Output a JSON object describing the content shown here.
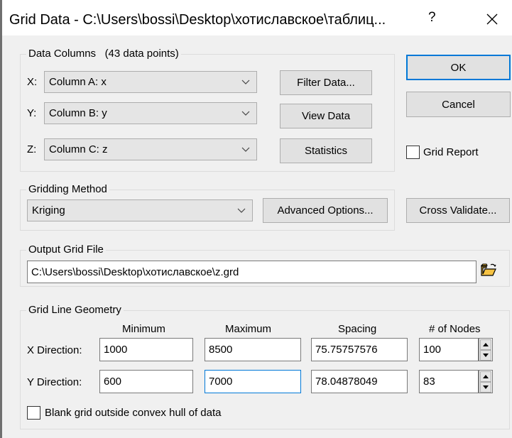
{
  "window": {
    "title": "Grid Data - C:\\Users\\bossi\\Desktop\\хотиславское\\таблиц...",
    "help_label": "?"
  },
  "data_columns": {
    "legend": "Data Columns",
    "count": "(43 data points)",
    "x_label": "X:",
    "x_value": "Column A:  x",
    "y_label": "Y:",
    "y_value": "Column B:  y",
    "z_label": "Z:",
    "z_value": "Column C:  z",
    "filter_button": "Filter Data...",
    "view_button": "View Data",
    "statistics_button": "Statistics"
  },
  "actions": {
    "ok": "OK",
    "cancel": "Cancel",
    "grid_report": "Grid Report",
    "cross_validate": "Cross Validate..."
  },
  "gridding_method": {
    "legend": "Gridding Method",
    "value": "Kriging",
    "advanced_button": "Advanced Options..."
  },
  "output_grid": {
    "legend": "Output Grid File",
    "path": "C:\\Users\\bossi\\Desktop\\хотиславское\\z.grd"
  },
  "geometry": {
    "legend": "Grid Line Geometry",
    "headers": {
      "minimum": "Minimum",
      "maximum": "Maximum",
      "spacing": "Spacing",
      "nodes": "# of Nodes"
    },
    "x": {
      "label": "X Direction:",
      "min": "1000",
      "max": "8500",
      "spacing": "75.75757576",
      "nodes": "100"
    },
    "y": {
      "label": "Y Direction:",
      "min": "600",
      "max": "7000",
      "spacing": "78.04878049",
      "nodes": "83"
    },
    "blank_hull": "Blank grid outside convex hull of data"
  },
  "colors": {
    "accent": "#0078d7",
    "dialog_bg": "#f0f0f0",
    "button_bg": "#e1e1e1"
  }
}
